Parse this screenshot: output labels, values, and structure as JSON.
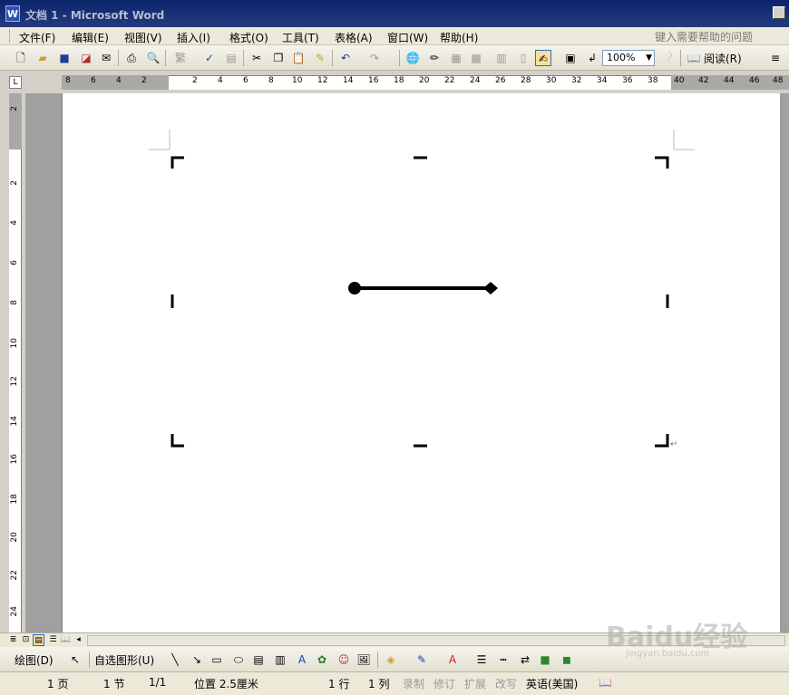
{
  "window": {
    "title": "文档 1 - Microsoft Word"
  },
  "menu": {
    "items": [
      {
        "label": "文件(F)"
      },
      {
        "label": "编辑(E)"
      },
      {
        "label": "视图(V)"
      },
      {
        "label": "插入(I)"
      },
      {
        "label": "格式(O)"
      },
      {
        "label": "工具(T)"
      },
      {
        "label": "表格(A)"
      },
      {
        "label": "窗口(W)"
      },
      {
        "label": "帮助(H)"
      }
    ],
    "help_placeholder": "键入需要帮助的问题"
  },
  "toolbar": {
    "zoom": "100%",
    "read_label": "阅读(R)"
  },
  "ruler": {
    "h_ticks": [
      "8",
      "6",
      "4",
      "2",
      "2",
      "4",
      "6",
      "8",
      "10",
      "12",
      "14",
      "16",
      "18",
      "20",
      "22",
      "24",
      "26",
      "28",
      "30",
      "32",
      "34",
      "36",
      "38",
      "40",
      "42",
      "44",
      "46",
      "48"
    ],
    "v_ticks": [
      "2",
      "2",
      "4",
      "6",
      "8",
      "10",
      "12",
      "14",
      "16",
      "18",
      "20",
      "22",
      "24"
    ]
  },
  "drawing_toolbar": {
    "draw_label": "绘图(D)",
    "autoshapes_label": "自选图形(U)"
  },
  "status": {
    "page": "1 页",
    "section": "1 节",
    "page_of": "1/1",
    "position": "位置 2.5厘米",
    "line": "1 行",
    "column": "1 列",
    "rec": "录制",
    "trk": "修订",
    "ext": "扩展",
    "ovr": "改写",
    "language": "英语(美国)"
  },
  "watermark": {
    "brand": "Baidu经验",
    "url": "jingyan.baidu.com"
  }
}
